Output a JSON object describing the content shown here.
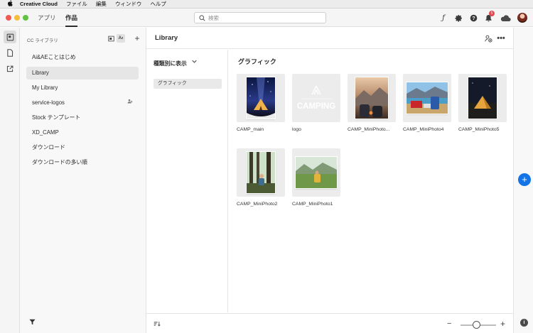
{
  "menubar": {
    "app_name": "Creative Cloud",
    "items": [
      "ファイル",
      "編集",
      "ウィンドウ",
      "ヘルプ"
    ]
  },
  "titlebar": {
    "tabs": [
      {
        "label": "アプリ",
        "active": false
      },
      {
        "label": "作品",
        "active": true
      }
    ],
    "search_placeholder": "検索",
    "notification_count": "5"
  },
  "library_panel": {
    "header": "CC ライブラリ",
    "items": [
      {
        "label": "Ai&AEことはじめ",
        "selected": false
      },
      {
        "label": "Library",
        "selected": true
      },
      {
        "label": "My Library",
        "selected": false
      },
      {
        "label": "service-logos",
        "selected": false,
        "shared": true
      },
      {
        "label": "Stock テンプレート",
        "selected": false
      },
      {
        "label": "XD_CAMP",
        "selected": false
      },
      {
        "label": "ダウンロード",
        "selected": false
      },
      {
        "label": "ダウンロードの多い順",
        "selected": false
      }
    ]
  },
  "main": {
    "title": "Library",
    "view_by_label": "種類別に表示",
    "filter_items": [
      "グラフィック"
    ],
    "section_title": "グラフィック",
    "assets": [
      {
        "label": "CAMP_main",
        "icon": "tent-night-photo"
      },
      {
        "label": "logo",
        "icon": "camping-logo",
        "logo_text": "CAMPING"
      },
      {
        "label": "CAMP_MiniPhoto...",
        "icon": "campfire-photo"
      },
      {
        "label": "CAMP_MiniPhoto4",
        "icon": "lake-camp-photo"
      },
      {
        "label": "CAMP_MiniPhoto5",
        "icon": "tent-dusk-photo"
      },
      {
        "label": "CAMP_MiniPhoto2",
        "icon": "forest-hiker-photo"
      },
      {
        "label": "CAMP_MiniPhoto1",
        "icon": "meadow-hiker-photo"
      }
    ]
  },
  "colors": {
    "accent": "#1473e6",
    "badge": "#e34850"
  }
}
